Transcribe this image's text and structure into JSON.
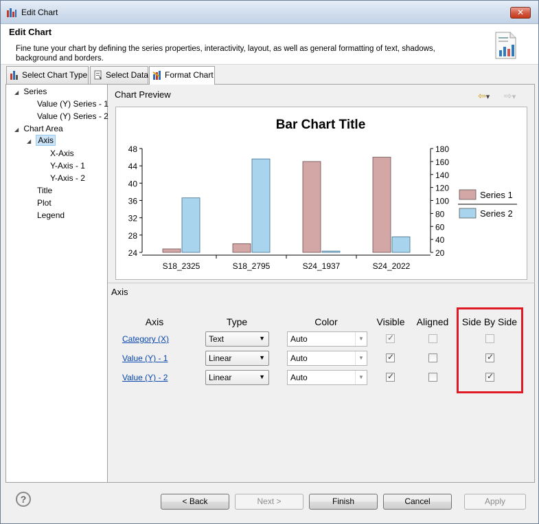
{
  "window": {
    "title": "Edit Chart",
    "close_label": "✕"
  },
  "header": {
    "title": "Edit Chart",
    "description": "Fine tune your chart by defining the series properties, interactivity, layout, as well as general formatting of text, shadows, background and borders."
  },
  "tabs": [
    {
      "label": "Select Chart Type",
      "icon": "chart-type-icon"
    },
    {
      "label": "Select Data",
      "icon": "data-icon"
    },
    {
      "label": "Format Chart",
      "icon": "format-chart-icon",
      "active": true
    }
  ],
  "tree": {
    "items": [
      {
        "label": "Series",
        "expanded": true
      },
      {
        "label": "Value (Y) Series - 1"
      },
      {
        "label": "Value (Y) Series - 2"
      },
      {
        "label": "Chart Area",
        "expanded": true
      },
      {
        "label": "Axis",
        "expanded": true,
        "selected": true
      },
      {
        "label": "X-Axis"
      },
      {
        "label": "Y-Axis - 1"
      },
      {
        "label": "Y-Axis - 2"
      },
      {
        "label": "Title"
      },
      {
        "label": "Plot"
      },
      {
        "label": "Legend"
      }
    ]
  },
  "preview": {
    "title": "Chart Preview",
    "back_glyph": "⇦",
    "forward_glyph": "⇨",
    "dropdown_glyph": "▾"
  },
  "chart_data": {
    "type": "bar",
    "title": "Bar Chart Title",
    "categories": [
      "S18_2325",
      "S18_2795",
      "S24_1937",
      "S24_2022"
    ],
    "series": [
      {
        "name": "Series 1",
        "values": [
          24.8,
          26,
          45,
          46
        ],
        "axis": "y1",
        "color": "#d4a7a7"
      },
      {
        "name": "Series 2",
        "values": [
          104,
          164,
          22,
          44
        ],
        "axis": "y2",
        "color": "#a8d4ee"
      }
    ],
    "y1": {
      "min": 24,
      "max": 48,
      "ticks": [
        24,
        28,
        32,
        36,
        40,
        44,
        48
      ]
    },
    "y2": {
      "min": 20,
      "max": 180,
      "ticks": [
        20,
        40,
        60,
        80,
        100,
        120,
        140,
        160,
        180
      ]
    },
    "legend_position": "right"
  },
  "axis_panel": {
    "title": "Axis",
    "headers": {
      "axis": "Axis",
      "type": "Type",
      "color": "Color",
      "visible": "Visible",
      "aligned": "Aligned",
      "side_by_side": "Side By Side"
    },
    "rows": [
      {
        "axis": "Category (X)",
        "type": "Text",
        "color": "Auto",
        "visible": true,
        "aligned": false,
        "side_by_side": false
      },
      {
        "axis": "Value (Y) - 1",
        "type": "Linear",
        "color": "Auto",
        "visible": true,
        "aligned": false,
        "side_by_side": true
      },
      {
        "axis": "Value (Y) - 2",
        "type": "Linear",
        "color": "Auto",
        "visible": true,
        "aligned": false,
        "side_by_side": true
      }
    ],
    "highlight_color": "#e01a25"
  },
  "buttons": {
    "help": "?",
    "back": "< Back",
    "next": "Next >",
    "finish": "Finish",
    "cancel": "Cancel",
    "apply": "Apply"
  }
}
